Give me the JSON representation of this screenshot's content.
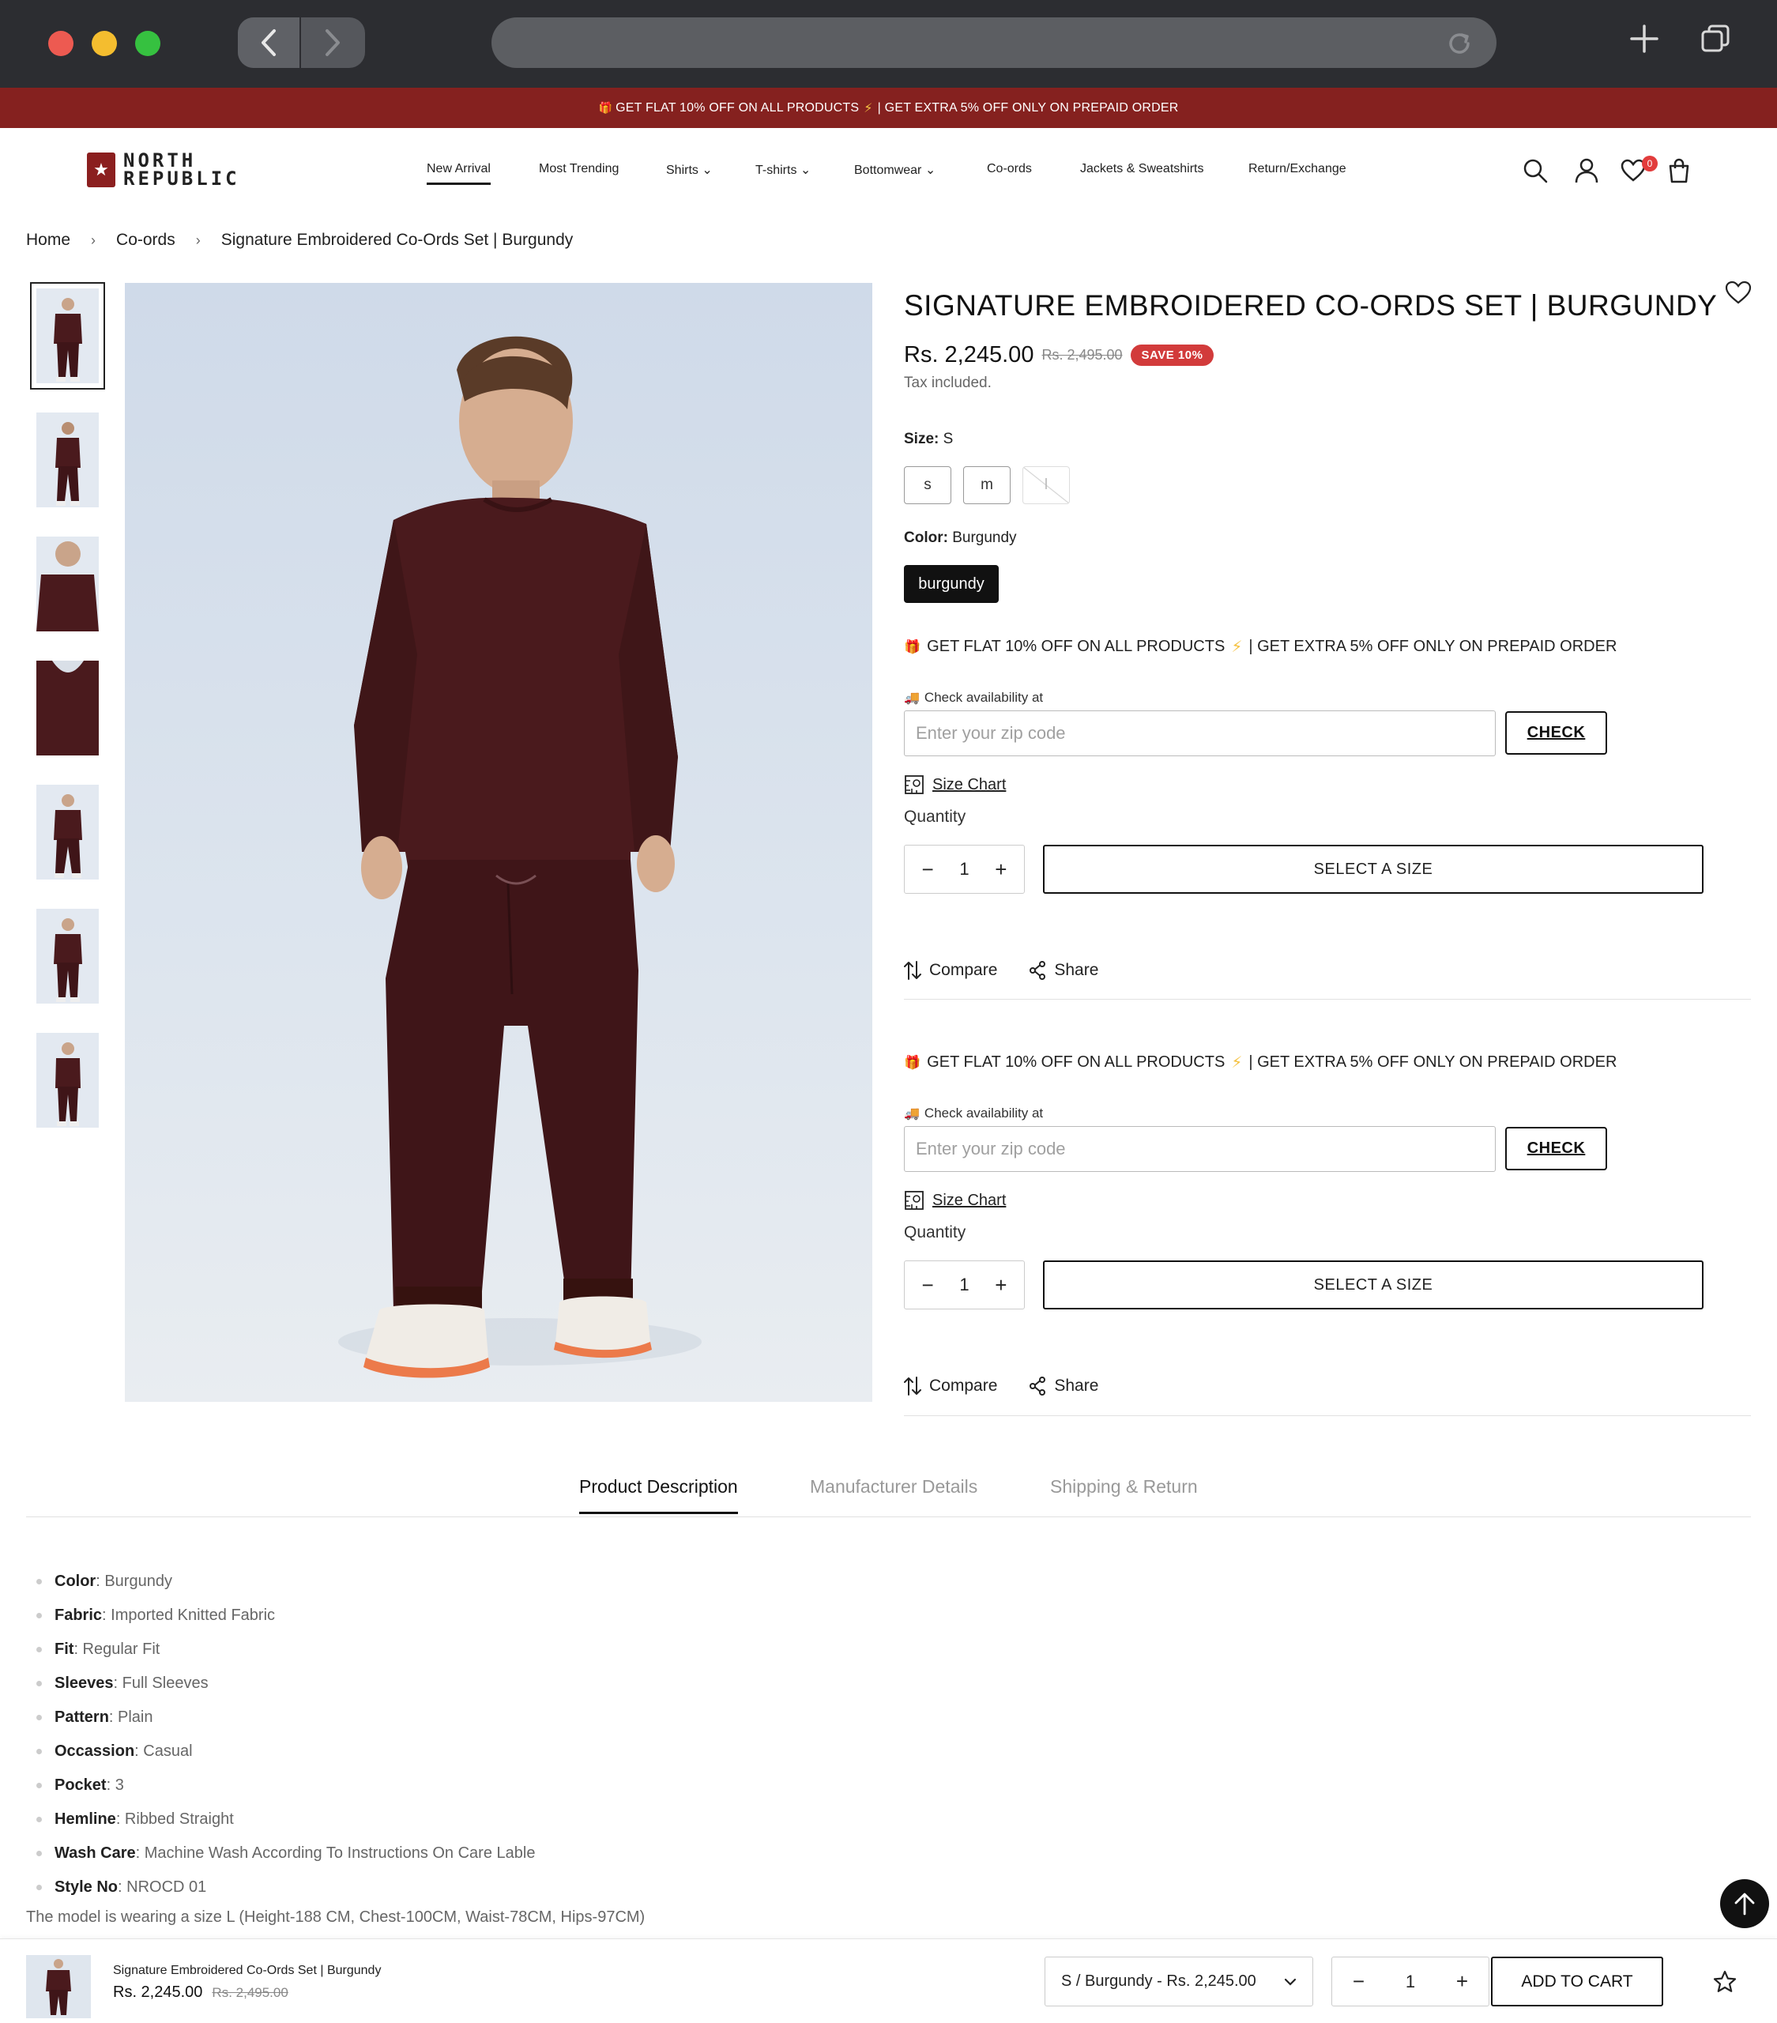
{
  "promo_bar": {
    "text_left": "GET FLAT 10% OFF ON ALL PRODUCTS",
    "text_right": "| GET EXTRA 5% OFF ONLY ON PREPAID ORDER"
  },
  "brand": {
    "logo_line1": "NORTH",
    "logo_line2": "REPUBLIC",
    "accent_color": "#85211f"
  },
  "nav": {
    "items": [
      {
        "label": "New Arrival"
      },
      {
        "label": "Most Trending"
      },
      {
        "label": "Shirts"
      },
      {
        "label": "T-shirts"
      },
      {
        "label": "Bottomwear"
      },
      {
        "label": "Co-ords"
      },
      {
        "label": "Jackets & Sweatshirts"
      },
      {
        "label": "Return/Exchange"
      }
    ],
    "wishlist_count": "0"
  },
  "breadcrumb": {
    "home": "Home",
    "category": "Co-ords",
    "current": "Signature Embroidered Co-Ords Set | Burgundy"
  },
  "product": {
    "title": "SIGNATURE EMBROIDERED CO-ORDS SET | BURGUNDY",
    "price": "Rs. 2,245.00",
    "compare_price": "Rs. 2,495.00",
    "save_badge": "SAVE 10%",
    "tax_note": "Tax included.",
    "size_label": "Size:",
    "size_selected": "S",
    "sizes": [
      "s",
      "m",
      "l"
    ],
    "color_label": "Color:",
    "color_selected": "Burgundy",
    "color_option": "burgundy",
    "product_color": "#4a1a1d"
  },
  "purchase_block": {
    "offer_left": "GET FLAT 10% OFF ON ALL PRODUCTS",
    "offer_right": "| GET EXTRA 5% OFF ONLY ON PREPAID ORDER",
    "availability_label": "Check availability at",
    "zip_placeholder": "Enter your zip code",
    "check_button": "CHECK",
    "size_chart": "Size Chart",
    "quantity_label": "Quantity",
    "quantity_value": "1",
    "add_button": "SELECT A SIZE",
    "compare_label": "Compare",
    "share_label": "Share"
  },
  "tabs": {
    "description": "Product Description",
    "manufacturer": "Manufacturer Details",
    "shipping": "Shipping & Return"
  },
  "description": {
    "items": [
      {
        "key": "Color",
        "value": ": Burgundy"
      },
      {
        "key": "Fabric",
        "value": ": Imported Knitted Fabric"
      },
      {
        "key": "Fit",
        "value": ": Regular Fit"
      },
      {
        "key": "Sleeves",
        "value": ": Full Sleeves"
      },
      {
        "key": "Pattern",
        "value": ": Plain"
      },
      {
        "key": "Occassion",
        "value": ": Casual"
      },
      {
        "key": "Pocket",
        "value": ": 3"
      },
      {
        "key": "Hemline",
        "value": ": Ribbed Straight"
      },
      {
        "key": "Wash Care",
        "value": ": Machine Wash According To Instructions On Care Lable"
      },
      {
        "key": "Style No",
        "value": ": NROCD 01"
      }
    ],
    "model_note": "The model is wearing a size L (Height-188 CM, Chest-100CM, Waist-78CM, Hips-97CM)"
  },
  "sticky_bar": {
    "name": "Signature Embroidered Co-Ords Set | Burgundy",
    "price": "Rs. 2,245.00",
    "compare_price": "Rs. 2,495.00",
    "variant": "S / Burgundy - Rs. 2,245.00",
    "quantity": "1",
    "add_to_cart": "ADD TO CART"
  }
}
